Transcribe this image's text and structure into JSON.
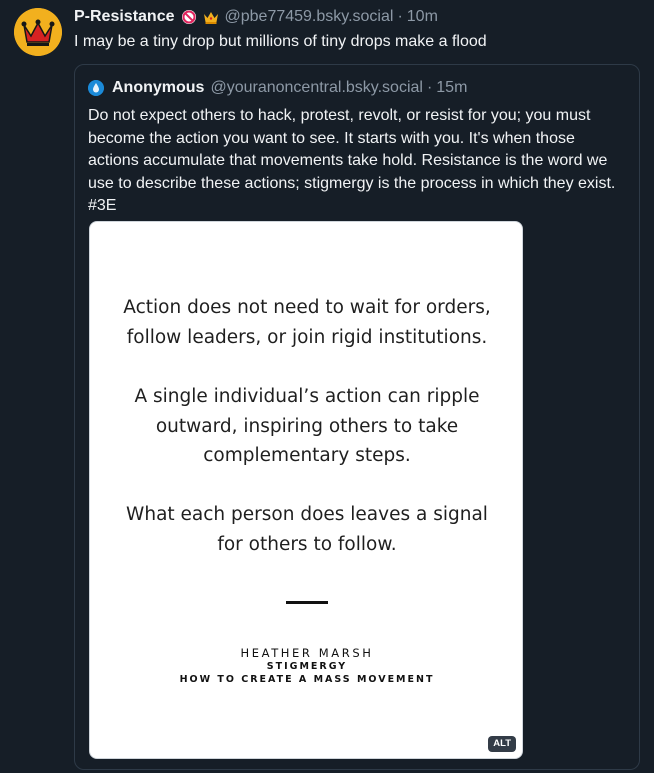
{
  "post": {
    "display_name": "P-Resistance",
    "badges": [
      "no-entry-icon",
      "crown-icon"
    ],
    "handle": "@pbe77459.bsky.social",
    "separator": "·",
    "time": "10m",
    "text": "I may be a tiny drop but millions of tiny drops make a flood",
    "avatar_icon": "crown-logo-icon",
    "colors": {
      "avatar_bg": "#f2b01e",
      "crown": "#d72222",
      "background": "#161e27",
      "muted": "#8d99a6"
    }
  },
  "quote": {
    "display_name": "Anonymous",
    "handle": "@youranoncentral.bsky.social",
    "separator": "·",
    "time": "15m",
    "text": "Do not expect others to hack, protest, revolt, or resist for you; you must become the action you want to see. It starts with you. It's when those actions accumulate that movements take hold. Resistance is the word we use to describe these actions; stigmergy is the process in which they exist. #3E",
    "avatar_icon": "droplet-avatar-icon",
    "image": {
      "paragraph_1": [
        "Action does not need to wait for orders,",
        "follow leaders, or join rigid institutions."
      ],
      "paragraph_2": [
        "A single individual’s action can ripple",
        "outward, inspiring others to take",
        "complementary steps."
      ],
      "paragraph_3": [
        "What each person does leaves a signal",
        "for others to follow."
      ],
      "author": "HEATHER MARSH",
      "book_title": "STIGMERGY",
      "book_subtitle": "HOW TO CREATE A MASS MOVEMENT",
      "alt_label": "ALT"
    }
  }
}
